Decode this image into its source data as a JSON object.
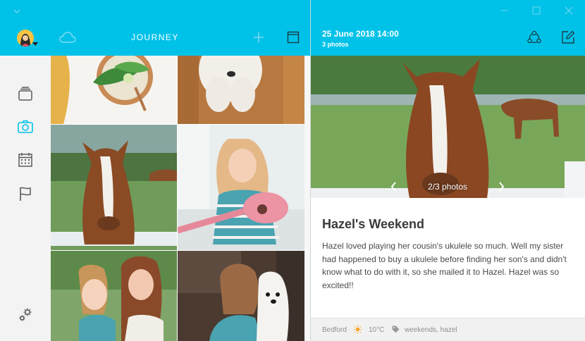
{
  "header": {
    "title": "JOURNEY"
  },
  "entry": {
    "date": "25 June 2018 14:00",
    "photo_count": "3 photos",
    "title": "Hazel's Weekend",
    "body": "Hazel loved playing her cousin's ukulele so much. Well my sister had happened to buy a ukulele before finding her son's and didn't know what to do with it, so she mailed it to Hazel. Hazel was so excited!!",
    "photo_counter": "2/3 photos",
    "location": "Bedford",
    "temperature": "10°C",
    "tags": "weekends, hazel"
  },
  "sidebar": {
    "items": [
      {
        "icon": "stack-icon",
        "active": false
      },
      {
        "icon": "camera-icon",
        "active": true
      },
      {
        "icon": "calendar-icon",
        "active": false
      },
      {
        "icon": "flag-icon",
        "active": false
      }
    ]
  },
  "colors": {
    "accent": "#00c2e8",
    "sidebar_bg": "#f3f3f3",
    "icon_inactive": "#5a5a5a",
    "weather_sun": "#f5a623"
  }
}
